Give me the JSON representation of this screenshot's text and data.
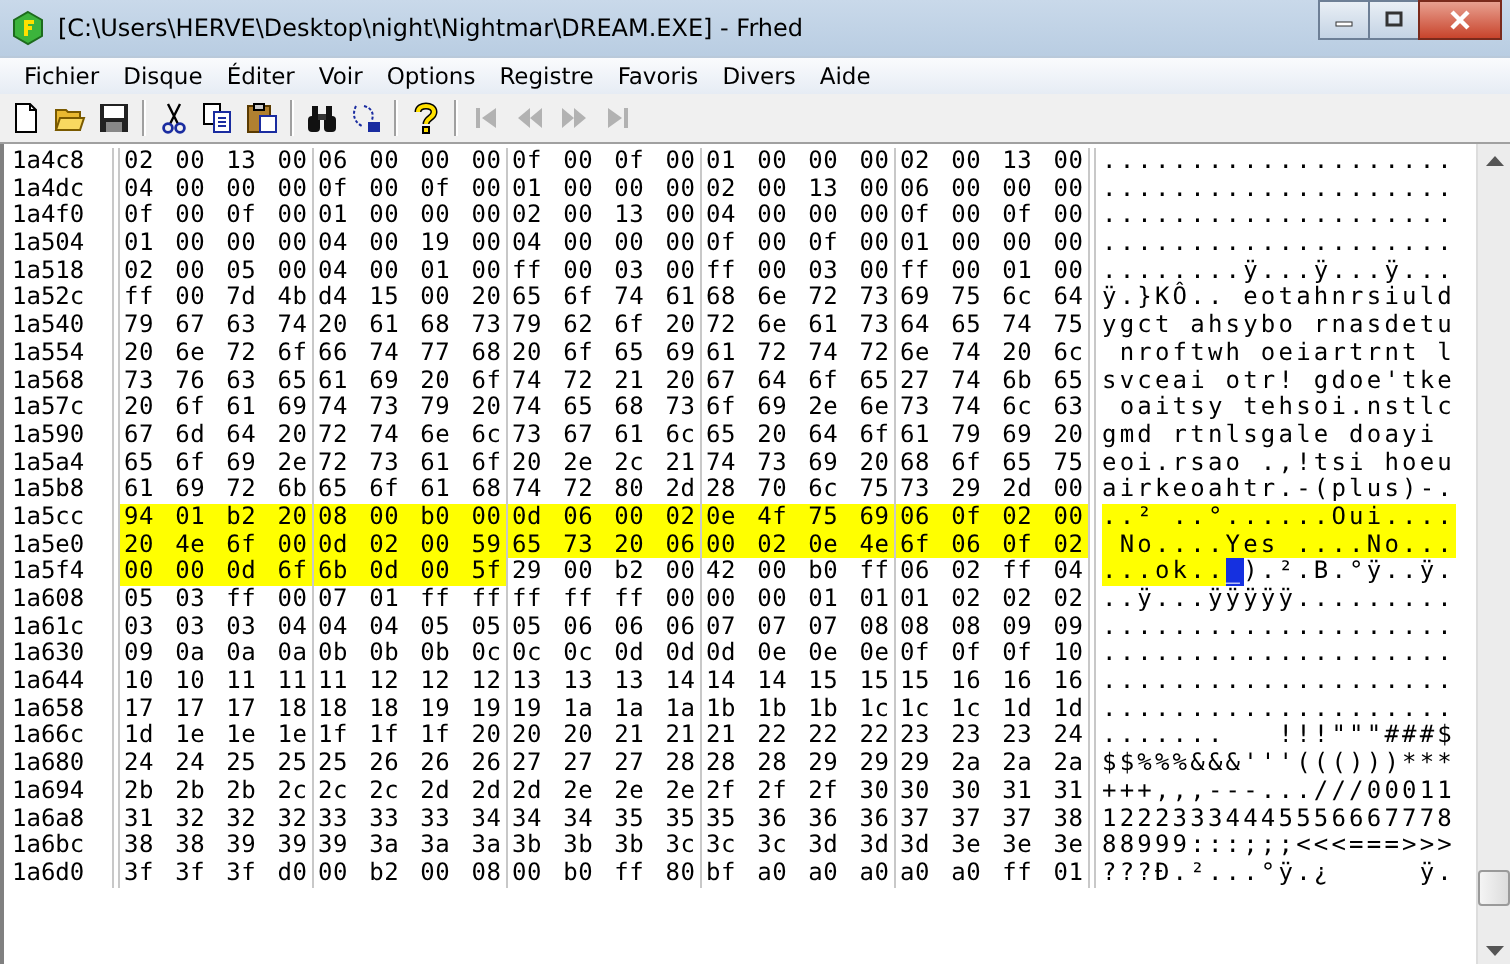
{
  "window": {
    "title": "[C:\\Users\\HERVE\\Desktop\\night\\Nightmar\\DREAM.EXE] - Frhed"
  },
  "menu": [
    "Fichier",
    "Disque",
    "Éditer",
    "Voir",
    "Options",
    "Registre",
    "Favoris",
    "Divers",
    "Aide"
  ],
  "toolbar": [
    {
      "kind": "new",
      "disabled": false
    },
    {
      "kind": "open",
      "disabled": false
    },
    {
      "kind": "save",
      "disabled": false
    },
    {
      "kind": "separator",
      "disabled": false
    },
    {
      "kind": "cut",
      "disabled": false
    },
    {
      "kind": "copy",
      "disabled": false
    },
    {
      "kind": "paste",
      "disabled": false
    },
    {
      "kind": "separator",
      "disabled": false
    },
    {
      "kind": "find",
      "disabled": false
    },
    {
      "kind": "replace",
      "disabled": false
    },
    {
      "kind": "separator",
      "disabled": false
    },
    {
      "kind": "help",
      "disabled": false
    },
    {
      "kind": "separator",
      "disabled": false
    },
    {
      "kind": "first",
      "disabled": true
    },
    {
      "kind": "prev",
      "disabled": true
    },
    {
      "kind": "next",
      "disabled": true
    },
    {
      "kind": "last",
      "disabled": true
    }
  ],
  "rows": [
    {
      "offset": "1a4c8",
      "groups": [
        {
          "hex": "02 00 13 00",
          "selected": false
        },
        {
          "hex": "06 00 00 00",
          "selected": false
        },
        {
          "hex": "0f 00 0f 00",
          "selected": false
        },
        {
          "hex": "01 00 00 00",
          "selected": false
        },
        {
          "hex": "02 00 13 00",
          "selected": false
        }
      ],
      "ascii": [
        {
          "text": "....................",
          "selected": false,
          "cursor": false
        }
      ]
    },
    {
      "offset": "1a4dc",
      "groups": [
        {
          "hex": "04 00 00 00",
          "selected": false
        },
        {
          "hex": "0f 00 0f 00",
          "selected": false
        },
        {
          "hex": "01 00 00 00",
          "selected": false
        },
        {
          "hex": "02 00 13 00",
          "selected": false
        },
        {
          "hex": "06 00 00 00",
          "selected": false
        }
      ],
      "ascii": [
        {
          "text": "....................",
          "selected": false,
          "cursor": false
        }
      ]
    },
    {
      "offset": "1a4f0",
      "groups": [
        {
          "hex": "0f 00 0f 00",
          "selected": false
        },
        {
          "hex": "01 00 00 00",
          "selected": false
        },
        {
          "hex": "02 00 13 00",
          "selected": false
        },
        {
          "hex": "04 00 00 00",
          "selected": false
        },
        {
          "hex": "0f 00 0f 00",
          "selected": false
        }
      ],
      "ascii": [
        {
          "text": "....................",
          "selected": false,
          "cursor": false
        }
      ]
    },
    {
      "offset": "1a504",
      "groups": [
        {
          "hex": "01 00 00 00",
          "selected": false
        },
        {
          "hex": "04 00 19 00",
          "selected": false
        },
        {
          "hex": "04 00 00 00",
          "selected": false
        },
        {
          "hex": "0f 00 0f 00",
          "selected": false
        },
        {
          "hex": "01 00 00 00",
          "selected": false
        }
      ],
      "ascii": [
        {
          "text": "....................",
          "selected": false,
          "cursor": false
        }
      ]
    },
    {
      "offset": "1a518",
      "groups": [
        {
          "hex": "02 00 05 00",
          "selected": false
        },
        {
          "hex": "04 00 01 00",
          "selected": false
        },
        {
          "hex": "ff 00 03 00",
          "selected": false
        },
        {
          "hex": "ff 00 03 00",
          "selected": false
        },
        {
          "hex": "ff 00 01 00",
          "selected": false
        }
      ],
      "ascii": [
        {
          "text": "........ÿ...ÿ...ÿ...",
          "selected": false,
          "cursor": false
        }
      ]
    },
    {
      "offset": "1a52c",
      "groups": [
        {
          "hex": "ff 00 7d 4b",
          "selected": false
        },
        {
          "hex": "d4 15 00 20",
          "selected": false
        },
        {
          "hex": "65 6f 74 61",
          "selected": false
        },
        {
          "hex": "68 6e 72 73",
          "selected": false
        },
        {
          "hex": "69 75 6c 64",
          "selected": false
        }
      ],
      "ascii": [
        {
          "text": "ÿ.}KÔ.. eotahnrsiuld",
          "selected": false,
          "cursor": false
        }
      ]
    },
    {
      "offset": "1a540",
      "groups": [
        {
          "hex": "79 67 63 74",
          "selected": false
        },
        {
          "hex": "20 61 68 73",
          "selected": false
        },
        {
          "hex": "79 62 6f 20",
          "selected": false
        },
        {
          "hex": "72 6e 61 73",
          "selected": false
        },
        {
          "hex": "64 65 74 75",
          "selected": false
        }
      ],
      "ascii": [
        {
          "text": "ygct ahsybo rnasdetu",
          "selected": false,
          "cursor": false
        }
      ]
    },
    {
      "offset": "1a554",
      "groups": [
        {
          "hex": "20 6e 72 6f",
          "selected": false
        },
        {
          "hex": "66 74 77 68",
          "selected": false
        },
        {
          "hex": "20 6f 65 69",
          "selected": false
        },
        {
          "hex": "61 72 74 72",
          "selected": false
        },
        {
          "hex": "6e 74 20 6c",
          "selected": false
        }
      ],
      "ascii": [
        {
          "text": " nroftwh oeiartrnt l",
          "selected": false,
          "cursor": false
        }
      ]
    },
    {
      "offset": "1a568",
      "groups": [
        {
          "hex": "73 76 63 65",
          "selected": false
        },
        {
          "hex": "61 69 20 6f",
          "selected": false
        },
        {
          "hex": "74 72 21 20",
          "selected": false
        },
        {
          "hex": "67 64 6f 65",
          "selected": false
        },
        {
          "hex": "27 74 6b 65",
          "selected": false
        }
      ],
      "ascii": [
        {
          "text": "svceai otr! gdoe'tke",
          "selected": false,
          "cursor": false
        }
      ]
    },
    {
      "offset": "1a57c",
      "groups": [
        {
          "hex": "20 6f 61 69",
          "selected": false
        },
        {
          "hex": "74 73 79 20",
          "selected": false
        },
        {
          "hex": "74 65 68 73",
          "selected": false
        },
        {
          "hex": "6f 69 2e 6e",
          "selected": false
        },
        {
          "hex": "73 74 6c 63",
          "selected": false
        }
      ],
      "ascii": [
        {
          "text": " oaitsy tehsoi.nstlc",
          "selected": false,
          "cursor": false
        }
      ]
    },
    {
      "offset": "1a590",
      "groups": [
        {
          "hex": "67 6d 64 20",
          "selected": false
        },
        {
          "hex": "72 74 6e 6c",
          "selected": false
        },
        {
          "hex": "73 67 61 6c",
          "selected": false
        },
        {
          "hex": "65 20 64 6f",
          "selected": false
        },
        {
          "hex": "61 79 69 20",
          "selected": false
        }
      ],
      "ascii": [
        {
          "text": "gmd rtnlsgale doayi",
          "selected": false,
          "cursor": false
        }
      ]
    },
    {
      "offset": "1a5a4",
      "groups": [
        {
          "hex": "65 6f 69 2e",
          "selected": false
        },
        {
          "hex": "72 73 61 6f",
          "selected": false
        },
        {
          "hex": "20 2e 2c 21",
          "selected": false
        },
        {
          "hex": "74 73 69 20",
          "selected": false
        },
        {
          "hex": "68 6f 65 75",
          "selected": false
        }
      ],
      "ascii": [
        {
          "text": "eoi.rsao .,!tsi hoeu",
          "selected": false,
          "cursor": false
        }
      ]
    },
    {
      "offset": "1a5b8",
      "groups": [
        {
          "hex": "61 69 72 6b",
          "selected": false
        },
        {
          "hex": "65 6f 61 68",
          "selected": false
        },
        {
          "hex": "74 72 80 2d",
          "selected": false
        },
        {
          "hex": "28 70 6c 75",
          "selected": false
        },
        {
          "hex": "73 29 2d 00",
          "selected": false
        }
      ],
      "ascii": [
        {
          "text": "airkeoahtr.-(plus)-.",
          "selected": false,
          "cursor": false
        }
      ]
    },
    {
      "offset": "1a5cc",
      "groups": [
        {
          "hex": "94 01 b2 20",
          "selected": true
        },
        {
          "hex": "08 00 b0 00",
          "selected": true
        },
        {
          "hex": "0d 06 00 02",
          "selected": true
        },
        {
          "hex": "0e 4f 75 69",
          "selected": true
        },
        {
          "hex": "06 0f 02 00",
          "selected": true
        }
      ],
      "ascii": [
        {
          "text": "..² ..°......Oui....",
          "selected": true,
          "cursor": false
        }
      ]
    },
    {
      "offset": "1a5e0",
      "groups": [
        {
          "hex": "20 4e 6f 00",
          "selected": true
        },
        {
          "hex": "0d 02 00 59",
          "selected": true
        },
        {
          "hex": "65 73 20 06",
          "selected": true
        },
        {
          "hex": "00 02 0e 4e",
          "selected": true
        },
        {
          "hex": "6f 06 0f 02",
          "selected": true
        }
      ],
      "ascii": [
        {
          "text": " No....Yes ....No...",
          "selected": true,
          "cursor": false
        }
      ]
    },
    {
      "offset": "1a5f4",
      "groups": [
        {
          "hex": "00 00 0d 6f",
          "selected": true
        },
        {
          "hex": "6b 0d 00 5f",
          "selected": true
        },
        {
          "hex": "29 00 b2 00",
          "selected": false
        },
        {
          "hex": "42 00 b0 ff",
          "selected": false
        },
        {
          "hex": "06 02 ff 04",
          "selected": false
        }
      ],
      "ascii": [
        {
          "text": "...ok..",
          "selected": true,
          "cursor": false
        },
        {
          "text": "_",
          "selected": true,
          "cursor": true
        },
        {
          "text": ").².B.°ÿ..ÿ.",
          "selected": false,
          "cursor": false
        }
      ]
    },
    {
      "offset": "1a608",
      "groups": [
        {
          "hex": "05 03 ff 00",
          "selected": false
        },
        {
          "hex": "07 01 ff ff",
          "selected": false
        },
        {
          "hex": "ff ff ff 00",
          "selected": false
        },
        {
          "hex": "00 00 01 01",
          "selected": false
        },
        {
          "hex": "01 02 02 02",
          "selected": false
        }
      ],
      "ascii": [
        {
          "text": "..ÿ...ÿÿÿÿÿ.........",
          "selected": false,
          "cursor": false
        }
      ]
    },
    {
      "offset": "1a61c",
      "groups": [
        {
          "hex": "03 03 03 04",
          "selected": false
        },
        {
          "hex": "04 04 05 05",
          "selected": false
        },
        {
          "hex": "05 06 06 06",
          "selected": false
        },
        {
          "hex": "07 07 07 08",
          "selected": false
        },
        {
          "hex": "08 08 09 09",
          "selected": false
        }
      ],
      "ascii": [
        {
          "text": "....................",
          "selected": false,
          "cursor": false
        }
      ]
    },
    {
      "offset": "1a630",
      "groups": [
        {
          "hex": "09 0a 0a 0a",
          "selected": false
        },
        {
          "hex": "0b 0b 0b 0c",
          "selected": false
        },
        {
          "hex": "0c 0c 0d 0d",
          "selected": false
        },
        {
          "hex": "0d 0e 0e 0e",
          "selected": false
        },
        {
          "hex": "0f 0f 0f 10",
          "selected": false
        }
      ],
      "ascii": [
        {
          "text": "....................",
          "selected": false,
          "cursor": false
        }
      ]
    },
    {
      "offset": "1a644",
      "groups": [
        {
          "hex": "10 10 11 11",
          "selected": false
        },
        {
          "hex": "11 12 12 12",
          "selected": false
        },
        {
          "hex": "13 13 13 14",
          "selected": false
        },
        {
          "hex": "14 14 15 15",
          "selected": false
        },
        {
          "hex": "15 16 16 16",
          "selected": false
        }
      ],
      "ascii": [
        {
          "text": "....................",
          "selected": false,
          "cursor": false
        }
      ]
    },
    {
      "offset": "1a658",
      "groups": [
        {
          "hex": "17 17 17 18",
          "selected": false
        },
        {
          "hex": "18 18 19 19",
          "selected": false
        },
        {
          "hex": "19 1a 1a 1a",
          "selected": false
        },
        {
          "hex": "1b 1b 1b 1c",
          "selected": false
        },
        {
          "hex": "1c 1c 1d 1d",
          "selected": false
        }
      ],
      "ascii": [
        {
          "text": "....................",
          "selected": false,
          "cursor": false
        }
      ]
    },
    {
      "offset": "1a66c",
      "groups": [
        {
          "hex": "1d 1e 1e 1e",
          "selected": false
        },
        {
          "hex": "1f 1f 1f 20",
          "selected": false
        },
        {
          "hex": "20 20 21 21",
          "selected": false
        },
        {
          "hex": "21 22 22 22",
          "selected": false
        },
        {
          "hex": "23 23 23 24",
          "selected": false
        }
      ],
      "ascii": [
        {
          "text": ".......   !!!\"\"\"###$",
          "selected": false,
          "cursor": false
        }
      ]
    },
    {
      "offset": "1a680",
      "groups": [
        {
          "hex": "24 24 25 25",
          "selected": false
        },
        {
          "hex": "25 26 26 26",
          "selected": false
        },
        {
          "hex": "27 27 27 28",
          "selected": false
        },
        {
          "hex": "28 28 29 29",
          "selected": false
        },
        {
          "hex": "29 2a 2a 2a",
          "selected": false
        }
      ],
      "ascii": [
        {
          "text": "$$%%%&&&'''((()))***",
          "selected": false,
          "cursor": false
        }
      ]
    },
    {
      "offset": "1a694",
      "groups": [
        {
          "hex": "2b 2b 2b 2c",
          "selected": false
        },
        {
          "hex": "2c 2c 2d 2d",
          "selected": false
        },
        {
          "hex": "2d 2e 2e 2e",
          "selected": false
        },
        {
          "hex": "2f 2f 2f 30",
          "selected": false
        },
        {
          "hex": "30 30 31 31",
          "selected": false
        }
      ],
      "ascii": [
        {
          "text": "+++,,,---...///00011",
          "selected": false,
          "cursor": false
        }
      ]
    },
    {
      "offset": "1a6a8",
      "groups": [
        {
          "hex": "31 32 32 32",
          "selected": false
        },
        {
          "hex": "33 33 33 34",
          "selected": false
        },
        {
          "hex": "34 34 35 35",
          "selected": false
        },
        {
          "hex": "35 36 36 36",
          "selected": false
        },
        {
          "hex": "37 37 37 38",
          "selected": false
        }
      ],
      "ascii": [
        {
          "text": "12223334445556667778",
          "selected": false,
          "cursor": false
        }
      ]
    },
    {
      "offset": "1a6bc",
      "groups": [
        {
          "hex": "38 38 39 39",
          "selected": false
        },
        {
          "hex": "39 3a 3a 3a",
          "selected": false
        },
        {
          "hex": "3b 3b 3b 3c",
          "selected": false
        },
        {
          "hex": "3c 3c 3d 3d",
          "selected": false
        },
        {
          "hex": "3d 3e 3e 3e",
          "selected": false
        }
      ],
      "ascii": [
        {
          "text": "88999:::;;;<<<===>>>",
          "selected": false,
          "cursor": false
        }
      ]
    },
    {
      "offset": "1a6d0",
      "groups": [
        {
          "hex": "3f 3f 3f d0",
          "selected": false
        },
        {
          "hex": "00 b2 00 08",
          "selected": false
        },
        {
          "hex": "00 b0 ff 80",
          "selected": false
        },
        {
          "hex": "bf a0 a0 a0",
          "selected": false
        },
        {
          "hex": "a0 a0 ff 01",
          "selected": false
        }
      ],
      "ascii": [
        {
          "text": "???Ð.²...°ÿ.¿     ÿ.",
          "selected": false,
          "cursor": false
        }
      ]
    }
  ]
}
